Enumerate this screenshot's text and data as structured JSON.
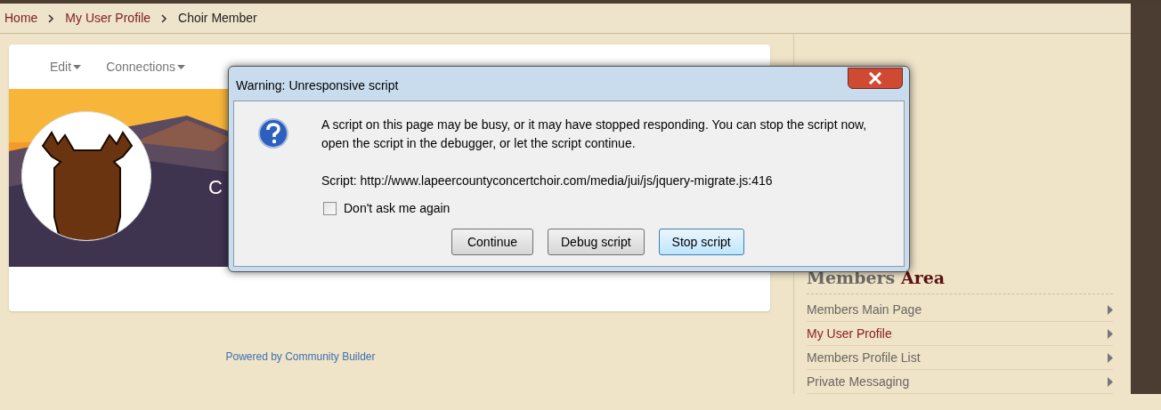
{
  "breadcrumb": [
    {
      "label": "Home",
      "current": false
    },
    {
      "label": "My User Profile",
      "current": false
    },
    {
      "label": "Choir Member",
      "current": true
    }
  ],
  "profile_menu": [
    {
      "label": "Edit"
    },
    {
      "label": "Connections"
    }
  ],
  "profile": {
    "name": "C"
  },
  "footer": "Powered by Community Builder",
  "sidebar": {
    "title": "Members",
    "title_accent": "Area",
    "items": [
      {
        "label": "Members Main Page",
        "selected": false
      },
      {
        "label": "My User Profile",
        "selected": true
      },
      {
        "label": "Members Profile List",
        "selected": false
      },
      {
        "label": "Private Messaging",
        "selected": false
      }
    ]
  },
  "dialog": {
    "title": "Warning: Unresponsive script",
    "message": "A script on this page may be busy, or it may have stopped responding. You can stop the script now, open the script in the debugger, or let the script continue.",
    "script_line": "Script: http://www.lapeercountyconcertchoir.com/media/jui/js/jquery-migrate.js:416",
    "checkbox": {
      "label": "Don't ask me again",
      "checked": false
    },
    "buttons": [
      {
        "label": "Continue",
        "focused": false
      },
      {
        "label": "Debug script",
        "focused": false
      },
      {
        "label": "Stop script",
        "focused": true
      }
    ]
  }
}
